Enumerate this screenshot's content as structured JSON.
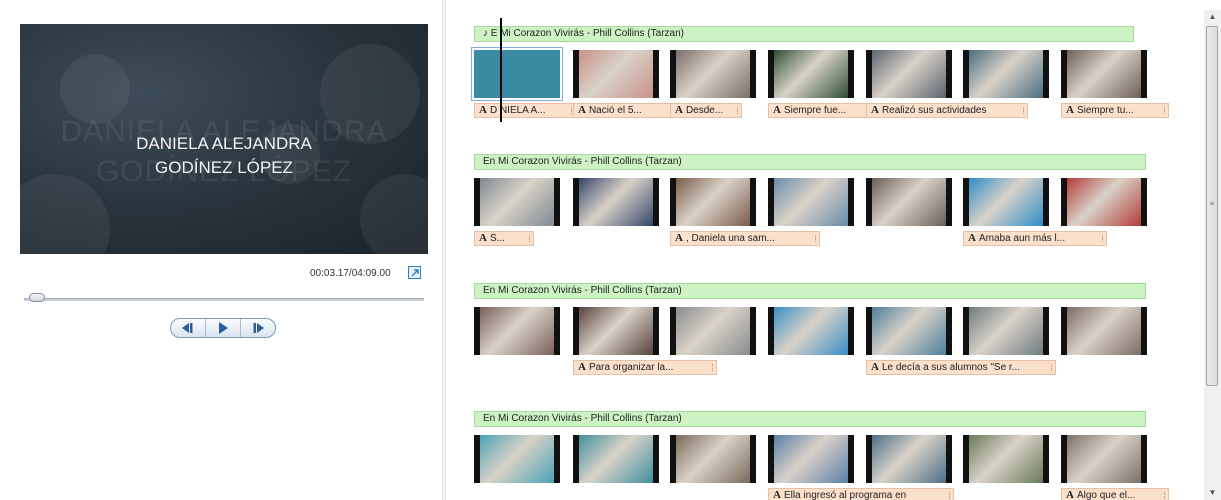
{
  "preview": {
    "title": "DANIELA ALEJANDRA\nGODÍNEZ LÓPEZ",
    "ghost_text": "DANIELA ALEJANDRA\nGODÍNEZ LÓPEZ",
    "timecode": "00:03.17/04:09.00",
    "seek_progress": 0.0128
  },
  "transport": {
    "prev_icon": "previous-frame-icon",
    "play_icon": "play-icon",
    "next_icon": "next-frame-icon"
  },
  "rows": [
    {
      "music": "♪ E  Mi Corazon Vivirás - Phill Collins (Tarzan)",
      "clips": [
        "#3a8aa3",
        "#c8928a",
        "#7a6e6a",
        "#2e4f35",
        "#5b6470",
        "#4a6e7e",
        "#6c5f58"
      ],
      "captions": [
        {
          "col": 0,
          "text": "D  NIELA A..."
        },
        {
          "col": 1,
          "text": "Nació  el 5..."
        },
        {
          "col": 2,
          "text": "Desde..."
        },
        {
          "col": 3,
          "text": "Siempre fue..."
        },
        {
          "col": 4,
          "text": "Realizó sus actividades"
        },
        {
          "col": 6,
          "text": "Siempre  tu..."
        }
      ]
    },
    {
      "music": "En Mi Corazon Vivirás - Phill Collins (Tarzan)",
      "clips": [
        "#7f8a92",
        "#34466a",
        "#7b5c4a",
        "#6a8caa",
        "#6a5f5a",
        "#2e8dc8",
        "#b23c36"
      ],
      "captions": [
        {
          "col": 0,
          "text": "S..."
        },
        {
          "col": 2,
          "text": ", Daniela una  sam..."
        },
        {
          "col": 5,
          "text": "Amaba  aun más  l..."
        }
      ]
    },
    {
      "music": "En Mi Corazon Vivirás - Phill Collins (Tarzan)",
      "clips": [
        "#7a5f5c",
        "#57433e",
        "#8a8c8e",
        "#3a8ec6",
        "#4d7f9c",
        "#6f7c80",
        "#7e6a66"
      ],
      "captions": [
        {
          "col": 1,
          "text": "Para organizar la..."
        },
        {
          "col": 4,
          "text": "Le decía a sus alumnos \"Se r..."
        }
      ]
    },
    {
      "music": "En Mi Corazon Vivirás - Phill Collins (Tarzan)",
      "clips": [
        "#4aa2b6",
        "#3f8f9e",
        "#7a6b5c",
        "#5c7ea8",
        "#4c6f86",
        "#6a7a5a",
        "#7a7268"
      ],
      "captions": [
        {
          "col": 3,
          "text": "Ella ingresó al programa en"
        },
        {
          "col": 6,
          "text": "Algo que el..."
        }
      ]
    }
  ]
}
